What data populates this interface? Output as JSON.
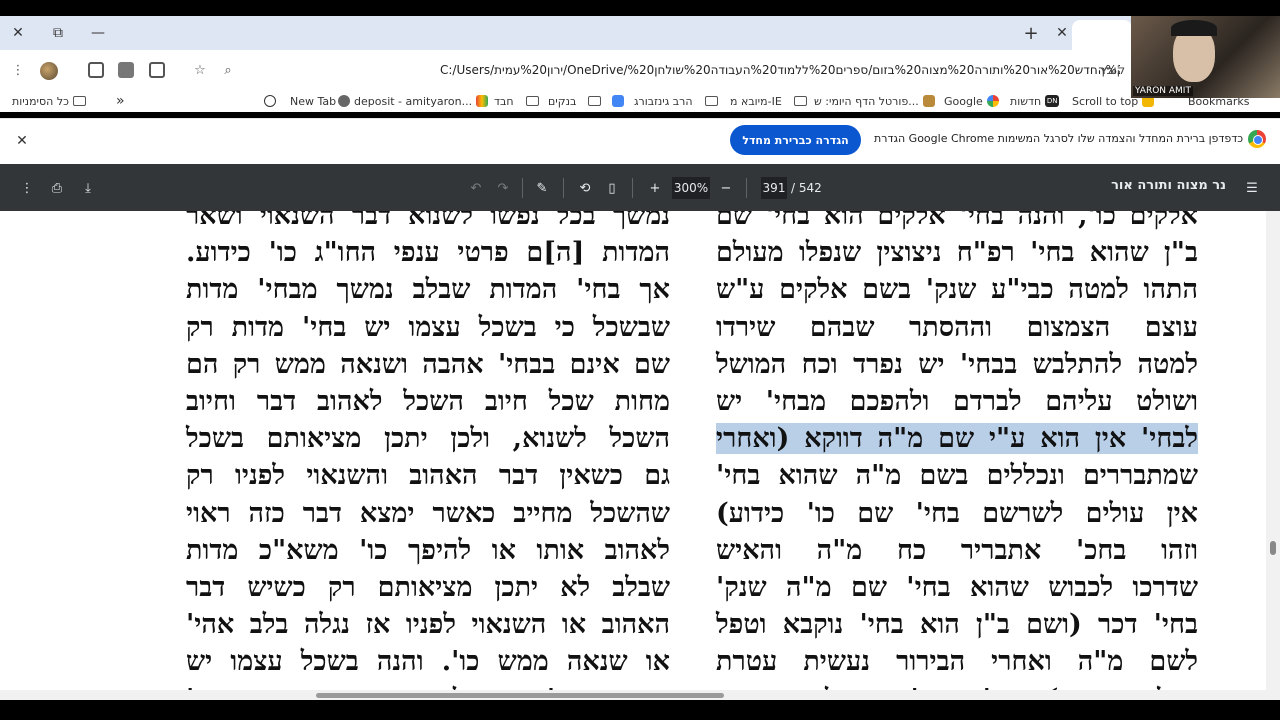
{
  "tab": {
    "close": "✕",
    "new": "+"
  },
  "window": {
    "close": "✕",
    "restore": "⧉",
    "minimize": "—"
  },
  "omnibox": {
    "prefix": "קובץ",
    "url": "C:/Users/ירון%20עמית/OneDrive/נר%20החדש%20אור%20ותורה%20מצוה%20בזום/ספרים%20ללמוד%20העבודה%20שולחן%20.pdf"
  },
  "bookmarks": {
    "overflow": "»",
    "all": "כל הסימניות",
    "items": [
      {
        "label": "New Tab"
      },
      {
        "label": "deposit - amityaron..."
      },
      {
        "label": "חבד"
      },
      {
        "label": "בנקים"
      },
      {
        "label": "הרב גינזבורג"
      },
      {
        "label": "מיובא מ-IE"
      },
      {
        "label": "פורטל הדף היומי: ש..."
      },
      {
        "label": "Google"
      },
      {
        "label": "חדשות"
      },
      {
        "label": "Scroll to top"
      },
      {
        "label": "Bookmarks"
      }
    ]
  },
  "infobar": {
    "text": "הגדרת Google Chrome כדפדפן ברירת המחדל והצמדה שלו לסרגל המשימות",
    "button": "הגדרה כברירת מחדל",
    "close": "✕"
  },
  "pdf": {
    "title": "נר מצוה ותורה אור",
    "page": "391",
    "total": "/ 542",
    "zoom": "300%"
  },
  "webcam": {
    "label": "YARON AMIT"
  },
  "document": {
    "right_column": [
      "אלקים כו', והנה בחי' אלקים הוא בחי' שם",
      "ב\"ן שהוא בחי' רפ\"ח ניצוצין שנפלו מעולם",
      "התהו למטה כבי\"ע שנק' בשם אלקים ע\"ש",
      "עוצם הצמצום וההסתר שבהם שירדו",
      "למטה להתלבש בבחי' יש נפרד וכח המושל",
      "ושולט עליהם לברדם ולהפכם מבחי' יש",
      "לבחי' אין הוא ע\"י שם מ\"ה דווקא (ואחרי",
      "שמתבררים ונכללים בשם מ\"ה שהוא בחי'",
      "אין עולים לשרשם בחי' שם כו' כידוע)",
      "וזהו בחכ' אתבריר כח מ\"ה והאיש",
      "שדרכו לכבוש שהוא בחי' שם מ\"ה שנק'",
      "בחי' דכר (ושם ב\"ן הוא בחי' נוקבא וטפל",
      "לשם מ\"ה ואחרי הבירור נעשית עטרת",
      "בעלה כידוע) וכו' בחי' ששולט בחשם"
    ],
    "highlight": "לבחי' אין הוא ע\"י שם מ\"ה דווקא (ואחרי",
    "left_column": [
      "נמשך בכל נפשו לשנוא דבר השנאוי ושאר",
      "המדות [ה]ם פרטי ענפי החו\"ג כו' כידוע.",
      "אך בחי' המדות שבלב נמשך מבחי' מדות",
      "שבשכל כי בשכל עצמו יש בחי' מדות רק",
      "שם אינם בבחי' אהבה ושנאה ממש רק הם",
      "מחות שכל חיוב השכל לאהוב דבר וחיוב",
      "השכל לשנוא, ולכן יתכן מציאותם בשכל",
      "גם כשאין דבר האהוב והשנאוי לפניו רק",
      "שהשכל מחייב כאשר ימצא דבר כזה ראוי",
      "לאהוב אותו או להיפך כו' משא\"כ מדות",
      "שבלב לא יתכן מציאותם רק כשיש דבר",
      "האהוב או השנאוי לפניו אז נגלה בלב אהי'",
      "או שנאה ממש כו'. והנה בשכל עצמו יש",
      "שתי בחי' בשכל האדם שנאה וכו'"
    ]
  }
}
